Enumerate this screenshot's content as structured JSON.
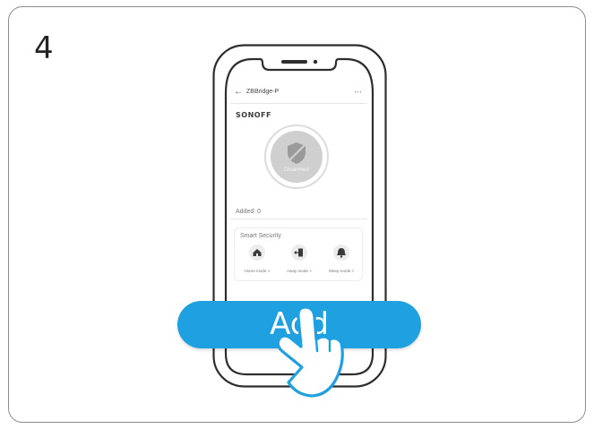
{
  "step": {
    "number": "4"
  },
  "app": {
    "back_icon": "arrow-left-icon",
    "device_title": "ZBBridge-P",
    "more_icon": "more-dots-icon",
    "brand": "SONOFF",
    "status": "Disarmed",
    "added": "Added: 0",
    "section_title": "Smart Security",
    "modes": [
      {
        "label": "Home mode >",
        "icon": "home-icon"
      },
      {
        "label": "Away mode >",
        "icon": "door-exit-icon"
      },
      {
        "label": "Sleep mode >",
        "icon": "sleep-bell-icon"
      }
    ]
  },
  "action": {
    "add_label": "Add"
  },
  "colors": {
    "accent": "#1fa0e0",
    "frame": "#333333",
    "disarmed": "#cfcfcf"
  }
}
